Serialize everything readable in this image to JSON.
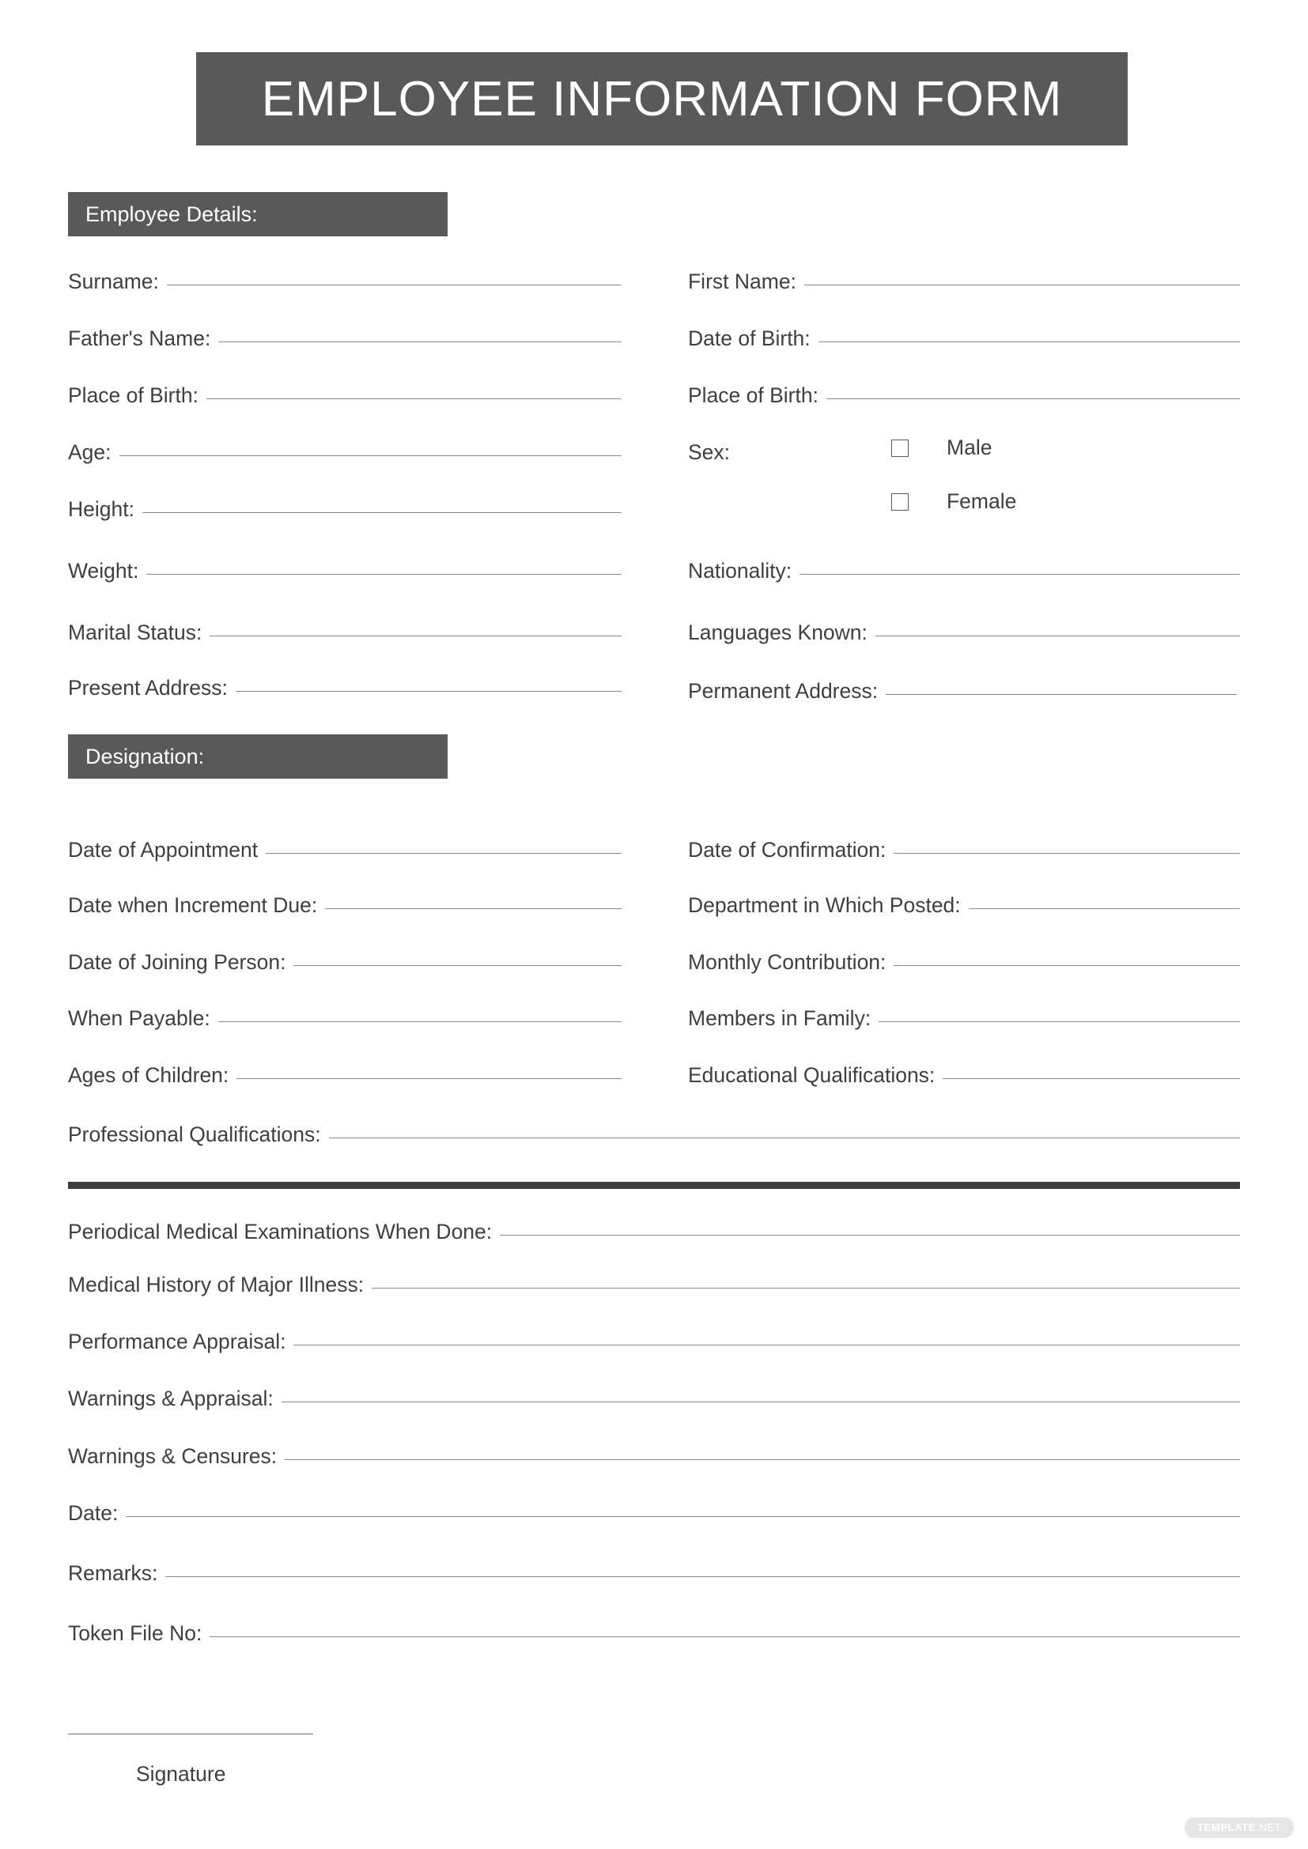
{
  "document": {
    "title": "EMPLOYEE INFORMATION FORM",
    "watermark": "TEMPLATE.NET",
    "watermark_prefix": "TEMPLATE",
    "watermark_suffix": ".NET"
  },
  "colors": {
    "banner_bg": "#595959",
    "banner_text": "#ffffff",
    "section_bg": "#595959",
    "label_text": "#3f3f3f",
    "rule_line": "#8a8a8a",
    "divider": "#3d3d3d",
    "page_bg": "#ffffff",
    "watermark_bg": "#e6e6e6"
  },
  "sections": {
    "employee_details": {
      "header": "Employee Details:",
      "left_fields": [
        {
          "label": "Surname:"
        },
        {
          "label": "Father's Name:"
        },
        {
          "label": "Place of Birth:"
        },
        {
          "label": "Age:"
        },
        {
          "label": "Height:"
        },
        {
          "label": "Weight:"
        },
        {
          "label": "Marital Status:"
        },
        {
          "label": "Present Address:"
        }
      ],
      "right_fields": [
        {
          "label": "First Name:"
        },
        {
          "label": "Date of Birth:"
        },
        {
          "label": "Place of Birth:"
        },
        {
          "label": "Nationality:"
        },
        {
          "label": "Languages Known:"
        },
        {
          "label": "Permanent Address:"
        }
      ],
      "sex": {
        "label": "Sex:",
        "options": [
          {
            "label": "Male",
            "checked": false
          },
          {
            "label": "Female",
            "checked": false
          }
        ]
      }
    },
    "designation": {
      "header": "Designation:",
      "left_fields": [
        {
          "label": "Date of Appointment"
        },
        {
          "label": "Date when Increment Due:"
        },
        {
          "label": "Date of Joining Person:"
        },
        {
          "label": "When Payable:"
        },
        {
          "label": "Ages of Children:"
        }
      ],
      "right_fields": [
        {
          "label": "Date of Confirmation:"
        },
        {
          "label": "Department in Which Posted:"
        },
        {
          "label": "Monthly Contribution:"
        },
        {
          "label": "Members in Family:"
        },
        {
          "label": "Educational Qualifications:"
        }
      ],
      "full_fields": [
        {
          "label": "Professional Qualifications:"
        }
      ]
    },
    "records": {
      "fields": [
        {
          "label": "Periodical Medical Examinations When Done:"
        },
        {
          "label": "Medical History of Major Illness:"
        },
        {
          "label": "Performance Appraisal:"
        },
        {
          "label": "Warnings & Appraisal:"
        },
        {
          "label": "Warnings & Censures:"
        },
        {
          "label": "Date:"
        },
        {
          "label": "Remarks:"
        },
        {
          "label": "Token File No:"
        }
      ]
    },
    "signature": {
      "label": "Signature"
    }
  }
}
